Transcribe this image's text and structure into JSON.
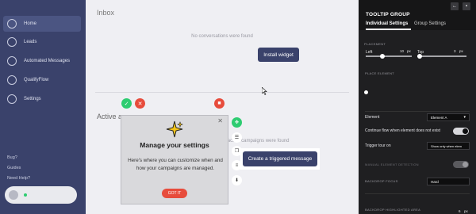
{
  "sidebar": {
    "items": [
      {
        "label": "Home",
        "icon": "home-icon"
      },
      {
        "label": "Leads",
        "icon": "leads-icon"
      },
      {
        "label": "Automated Messages",
        "icon": "messages-icon"
      },
      {
        "label": "QualifyFlow",
        "icon": "flow-icon"
      },
      {
        "label": "Settings",
        "icon": "settings-icon"
      }
    ],
    "bottom_links": [
      "Bug?",
      "Guides",
      "Need Help?"
    ]
  },
  "main": {
    "inbox_title": "Inbox",
    "no_conversations": "No conversations were found",
    "install_widget": "Install widget",
    "active_title": "Active au",
    "no_campaigns": "No active campaigns were found"
  },
  "tooltip": {
    "title": "Manage your settings",
    "body": "Here's where you can customize when and how your campaigns are managed.",
    "button": "GOT IT",
    "close": "✕"
  },
  "highlight": {
    "button": "Create a triggered message"
  },
  "panel": {
    "title": "TOOLTIP GROUP",
    "tabs": [
      "Individual Settings",
      "Group Settings"
    ],
    "placement_label": "PLACEMENT",
    "left_label": "Left",
    "left_value": "10",
    "left_unit": "px",
    "top_label": "Top",
    "top_value": "3",
    "top_unit": "px",
    "place_element_label": "PLACE ELEMENT",
    "element_label": "Element",
    "element_value": "Element A",
    "continue_label": "Continue flow when element does not exist",
    "trigger_label": "Trigger tour on",
    "trigger_value": "Show only when elem",
    "manual_label": "MANUAL ELEMENT DETECTION",
    "backdrop_focus_label": "BACKDROP FOCUS",
    "backdrop_focus_value": "Hard",
    "backdrop_area_label": "BACKDROP HIGHLIGHTED AREA",
    "backdrop_area_value": "6",
    "backdrop_area_unit": "px"
  },
  "colors": {
    "sidebar": "#3a426b",
    "accent_red": "#e74c3c",
    "accent_green": "#2ecc71",
    "panel_bg": "#1f1f21"
  }
}
